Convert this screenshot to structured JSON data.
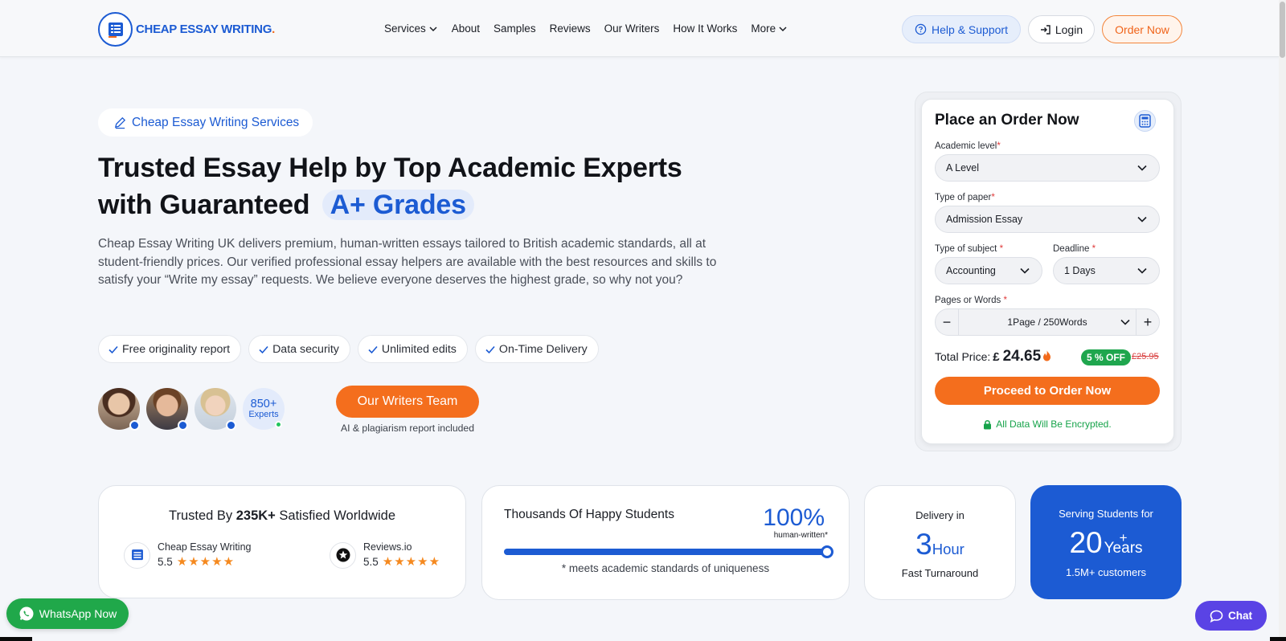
{
  "colors": {
    "primary": "#1c5bd3",
    "accent": "#f46e1d",
    "success": "#1fa64e",
    "chat": "#5a43e5"
  },
  "header": {
    "logo_text": "CHEAP ESSAY WRITING",
    "logo_dot": ".",
    "nav": [
      {
        "label": "Services",
        "dropdown": true
      },
      {
        "label": "About"
      },
      {
        "label": "Samples"
      },
      {
        "label": "Reviews"
      },
      {
        "label": "Our Writers"
      },
      {
        "label": "How It Works"
      },
      {
        "label": "More",
        "dropdown": true
      }
    ],
    "help_label": "Help & Support",
    "login_label": "Login",
    "order_label": "Order Now"
  },
  "hero": {
    "pill_label": "Cheap Essay Writing Services",
    "title_line1": "Trusted Essay Help by Top Academic Experts",
    "title_line2": "with Guaranteed",
    "title_highlight": "A+ Grades",
    "description": "Cheap Essay Writing UK delivers premium, human-written essays tailored to British academic standards, all at student-friendly prices. Our verified professional essay helpers are available with the best resources and skills to satisfy your “Write my essay” requests. We believe everyone deserves the highest grade, so why not you?",
    "features": [
      "Free originality report",
      "Data security",
      "Unlimited edits",
      "On-Time Delivery"
    ],
    "experts_count": "850+",
    "experts_label": "Experts",
    "writers_button": "Our Writers Team",
    "writers_note": "AI & plagiarism report included"
  },
  "order": {
    "title": "Place an Order Now",
    "academic_level_label": "Academic level",
    "academic_level_value": "A Level",
    "paper_type_label": "Type of paper",
    "paper_type_value": "Admission Essay",
    "subject_label": "Type of subject",
    "subject_value": "Accounting",
    "deadline_label": "Deadline",
    "deadline_value": "1 Days",
    "pages_label": "Pages or Words",
    "pages_value": "1Page / 250Words",
    "required_mark": "*",
    "total_label": "Total Price:",
    "currency": "£",
    "price": "24.65",
    "discount": "5 % OFF",
    "old_price": "£25.95",
    "proceed_label": "Proceed to Order Now",
    "secure_note": "All Data Will Be Encrypted."
  },
  "stats": {
    "trusted_prefix": "Trusted By ",
    "trusted_bold": "235K+",
    "trusted_suffix": " Satisfied Worldwide",
    "reviews": [
      {
        "name": "Cheap Essay Writing",
        "rating": "5.5",
        "stars": "★★★★★"
      },
      {
        "name": "Reviews.io",
        "rating": "5.5",
        "stars": "★★★★★"
      }
    ],
    "happy_title": "Thousands Of Happy Students",
    "happy_pct": "100%",
    "happy_pct_sub": "human-written*",
    "happy_progress": 1.0,
    "happy_note": "* meets academic standards of uniqueness",
    "delivery_top": "Delivery in",
    "delivery_num": "3",
    "delivery_unit": "Hour",
    "delivery_bottom": "Fast Turnaround",
    "serving_top": "Serving Students for",
    "serving_num": "20",
    "serving_plus": "+",
    "serving_unit": "Years",
    "serving_bottom": "1.5M+ customers"
  },
  "floaters": {
    "whatsapp_label": "WhatsApp Now",
    "chat_label": "Chat"
  }
}
